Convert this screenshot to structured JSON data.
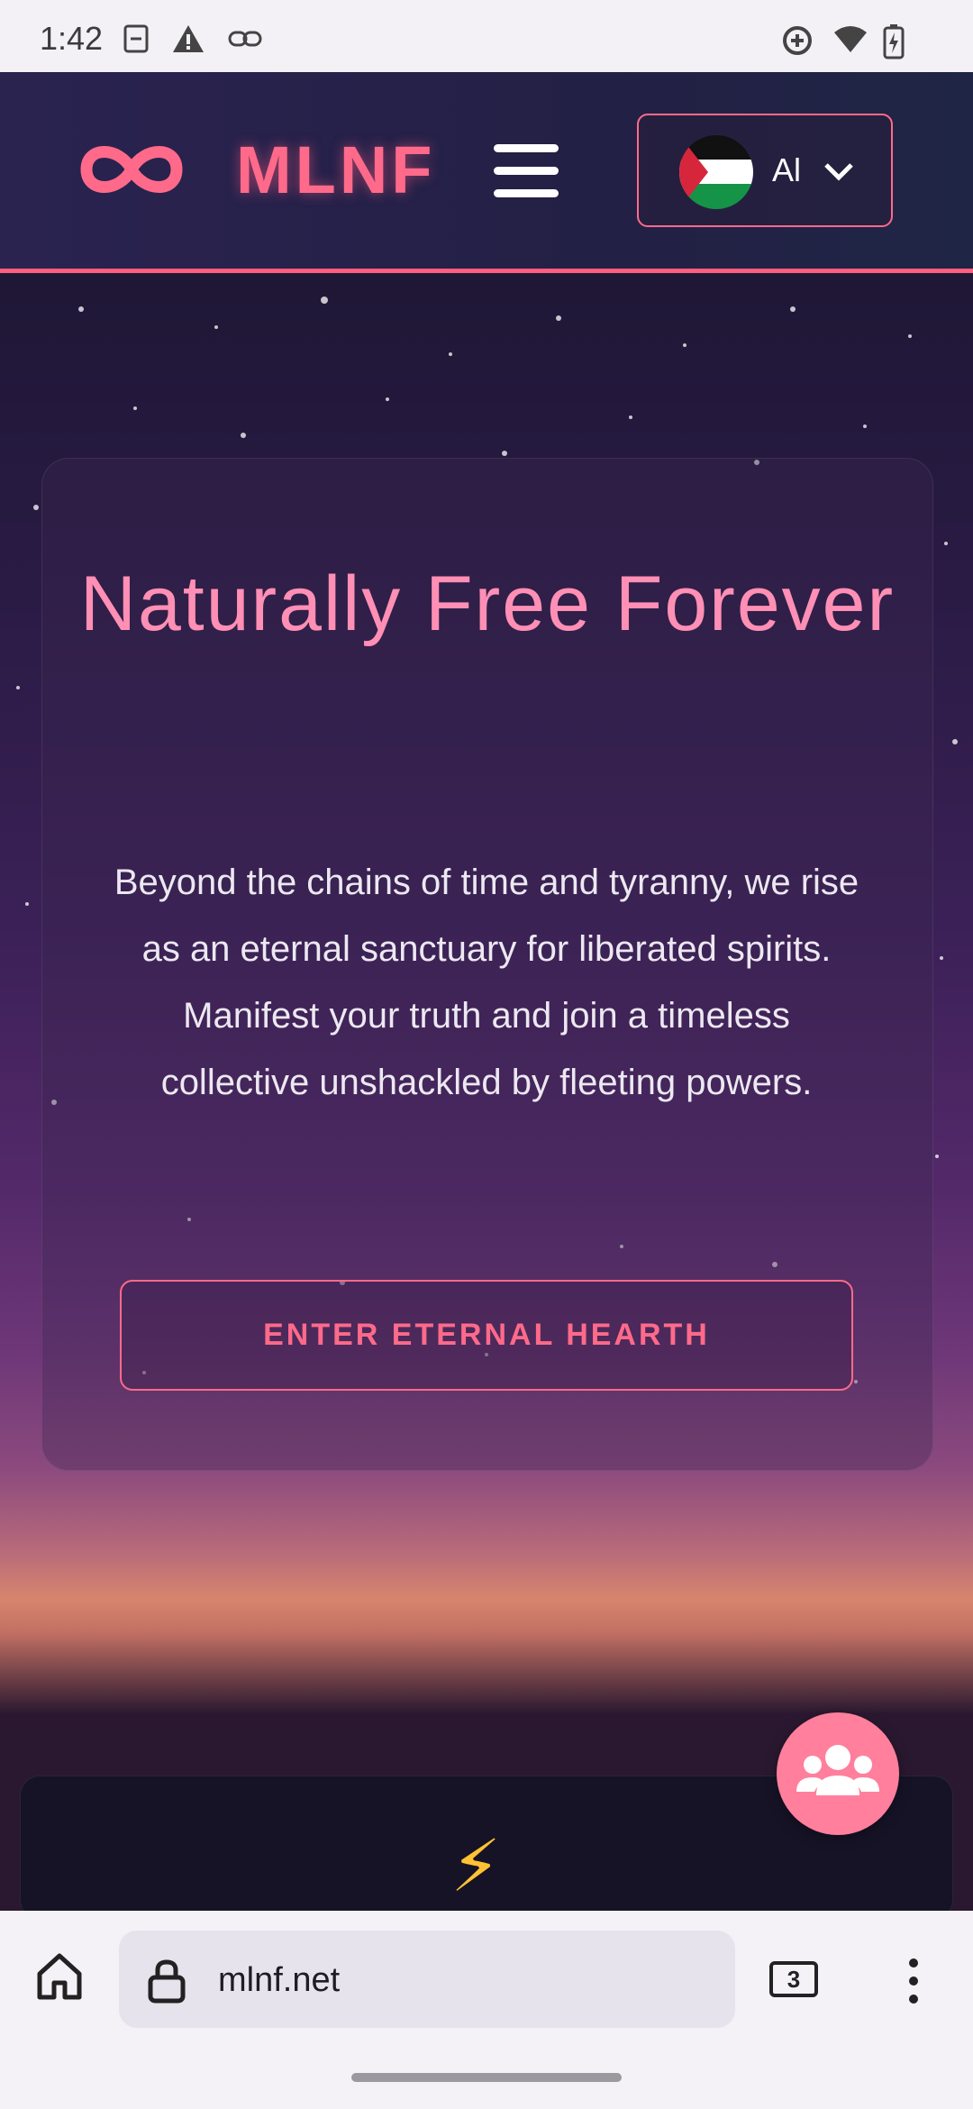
{
  "status_bar": {
    "time": "1:42"
  },
  "header": {
    "logo_text": "MLNF",
    "language": {
      "code": "Al",
      "flag": "palestine-flag-icon"
    }
  },
  "hero": {
    "title": "Naturally Free Forever",
    "text": "Beyond the chains of time and tyranny, we rise as an eternal sanctuary for liberated spirits. Manifest your truth and join a timeless collective unshackled by fleeting powers.",
    "cta_label": "ENTER ETERNAL HEARTH"
  },
  "feature_card": {
    "icon": "lightning-bolt-icon",
    "icon_glyph": "⚡"
  },
  "browser": {
    "url": "mlnf.net",
    "tab_count": "3"
  },
  "colors": {
    "accent": "#ff6a8a",
    "title": "#ff8fb5",
    "header_bg": "#252148"
  }
}
